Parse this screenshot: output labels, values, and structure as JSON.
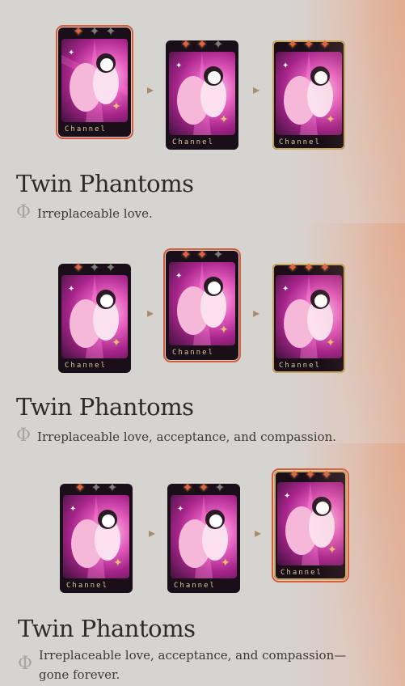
{
  "colors": {
    "accent_selected": "#d65b3a",
    "star_on": "#e0643c",
    "star_off": "#7d7b78",
    "arrow": "#a88b6a",
    "text": "#2d2a29"
  },
  "card": {
    "brand_label": "Channel"
  },
  "arrow_glyph": "▸",
  "symbol_glyph": "Φ",
  "panels": [
    {
      "title": "Twin Phantoms",
      "description": "Irreplaceable love.",
      "selected_card": 1,
      "cards": [
        {
          "stars_on": 1,
          "stars_total": 3
        },
        {
          "stars_on": 2,
          "stars_total": 3
        },
        {
          "stars_on": 3,
          "stars_total": 3
        }
      ]
    },
    {
      "title": "Twin Phantoms",
      "description": "Irreplaceable love, acceptance, and compassion.",
      "selected_card": 2,
      "cards": [
        {
          "stars_on": 1,
          "stars_total": 3
        },
        {
          "stars_on": 2,
          "stars_total": 3
        },
        {
          "stars_on": 3,
          "stars_total": 3
        }
      ]
    },
    {
      "title": "Twin Phantoms",
      "description": "Irreplaceable love, acceptance, and compassion—gone forever.",
      "selected_card": 3,
      "cards": [
        {
          "stars_on": 1,
          "stars_total": 3
        },
        {
          "stars_on": 2,
          "stars_total": 3
        },
        {
          "stars_on": 3,
          "stars_total": 3
        }
      ]
    }
  ]
}
